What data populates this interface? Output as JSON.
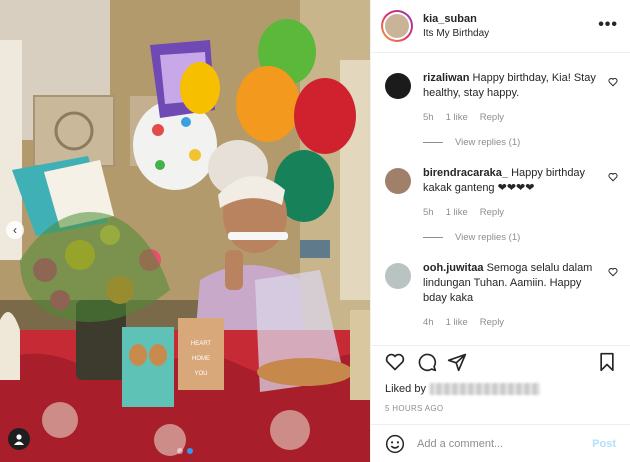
{
  "post": {
    "username": "kia_suban",
    "location": "Its My Birthday",
    "more_label": "•••"
  },
  "comments": [
    {
      "username": "rizaliwan",
      "text": "Happy birthday, Kia! Stay healthy, stay happy.",
      "age": "5h",
      "likes": "1 like",
      "reply_label": "Reply",
      "view_replies": "View replies (1)",
      "avatar_color": "#1b1b1b"
    },
    {
      "username": "birendracaraka_",
      "text": "Happy birthday kakak ganteng ❤❤❤❤",
      "age": "5h",
      "likes": "1 like",
      "reply_label": "Reply",
      "view_replies": "View replies (1)",
      "avatar_color": "#a0806a"
    },
    {
      "username": "ooh.juwitaa",
      "text": "Semoga selalu dalam lindungan Tuhan. Aamiin. Happy bday kaka",
      "age": "4h",
      "likes": "1 like",
      "reply_label": "Reply",
      "avatar_color": "#b9c4c2"
    }
  ],
  "likes_prefix": "Liked by",
  "timestamp": "5 HOURS AGO",
  "add_comment": {
    "placeholder": "Add a comment...",
    "post_label": "Post"
  },
  "photo": {
    "card_text": "HEART HOME YOU",
    "nav_prev": "‹"
  },
  "colors": {
    "accent": "#3897f0",
    "muted": "#8e8e8e",
    "post_disabled": "#b2dffc",
    "heart_red": "#ed4956"
  }
}
